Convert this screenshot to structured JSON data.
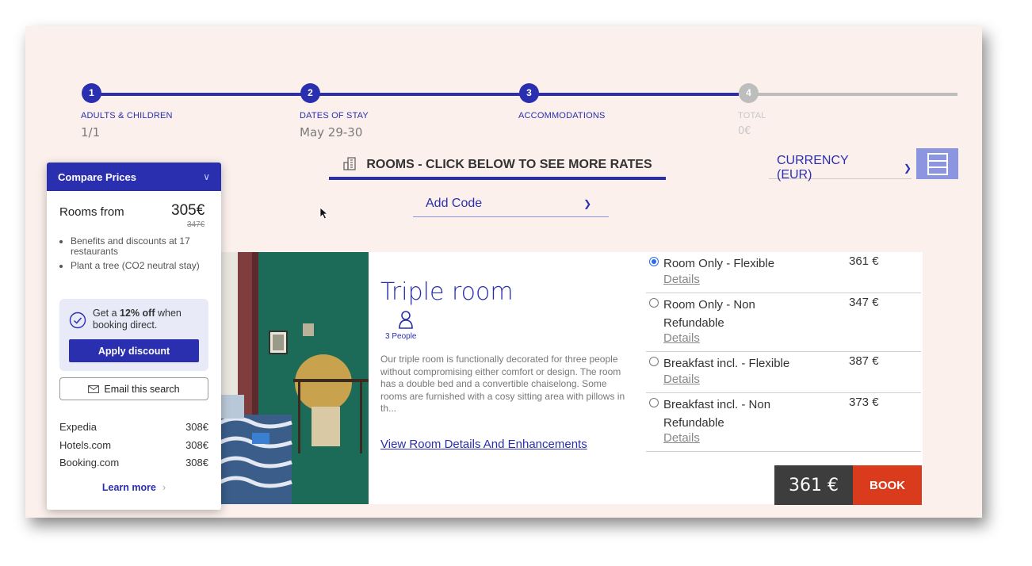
{
  "steps": [
    {
      "number": "1",
      "title": "ADULTS & CHILDREN",
      "value": "1/1"
    },
    {
      "number": "2",
      "title": "DATES OF STAY",
      "value": "May 29-30"
    },
    {
      "number": "3",
      "title": "ACCOMMODATIONS",
      "value": ""
    },
    {
      "number": "4",
      "title": "TOTAL",
      "value": "0€"
    }
  ],
  "colors": {
    "accent": "#2a2fb0",
    "book": "#d93b1c",
    "background": "#fbf0ec",
    "inactive_step": "#bdbdbd"
  },
  "header": {
    "rooms_title": "ROOMS - CLICK BELOW TO SEE MORE RATES",
    "rooms_icon": "building-icon",
    "currency_label": "CURRENCY (EUR)",
    "add_code_label": "Add Code",
    "menu_icon": "menu-icon"
  },
  "room": {
    "title": "Triple room",
    "people": "3 People",
    "description": "Our triple room is functionally decorated for three people without compromising either comfort or design. The room has a double bed and a convertible chaiselong. Some rooms are furnished with a cosy sitting area with pillows in th...",
    "link": "View Room Details And Enhancements"
  },
  "rates": [
    {
      "name": "Room Only - Flexible",
      "price": "361 €",
      "details": "Details",
      "selected": true
    },
    {
      "name": "Room Only - Non Refundable",
      "price": "347 €",
      "details": "Details",
      "selected": false
    },
    {
      "name": "Breakfast incl. - Flexible",
      "price": "387 €",
      "details": "Details",
      "selected": false
    },
    {
      "name": "Breakfast incl. - Non Refundable",
      "price": "373 €",
      "details": "Details",
      "selected": false
    }
  ],
  "booking": {
    "price": "361 €",
    "button": "BOOK"
  },
  "compare": {
    "title": "Compare Prices",
    "rooms_from_label": "Rooms from",
    "price": "305€",
    "old_price": "347€",
    "benefits": [
      "Benefits and discounts at 17 restaurants",
      "Plant a tree (CO2 neutral stay)"
    ],
    "promo_prefix": "Get a ",
    "promo_bold": "12% off",
    "promo_suffix": " when booking direct.",
    "apply_label": "Apply discount",
    "email_label": "Email this search",
    "otas": [
      {
        "name": "Expedia",
        "price": "308€"
      },
      {
        "name": "Hotels.com",
        "price": "308€"
      },
      {
        "name": "Booking.com",
        "price": "308€"
      }
    ],
    "learn_more": "Learn more"
  }
}
